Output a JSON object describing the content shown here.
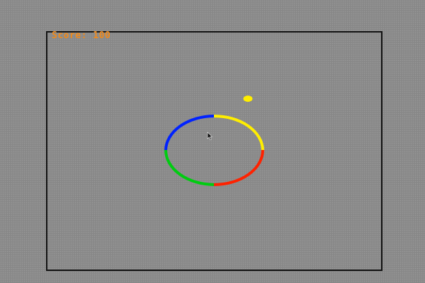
{
  "hud": {
    "score_label": "Score: 100"
  },
  "ring": {
    "segments": [
      {
        "name": "blue-segment",
        "color": "#0022ff"
      },
      {
        "name": "yellow-segment",
        "color": "#ffee00"
      },
      {
        "name": "red-segment",
        "color": "#ff2200"
      },
      {
        "name": "green-segment",
        "color": "#00cc11"
      }
    ]
  },
  "ball": {
    "color": "#ffee00"
  },
  "cursor": {
    "icon": "mouse-pointer-icon",
    "color": "#111111"
  }
}
